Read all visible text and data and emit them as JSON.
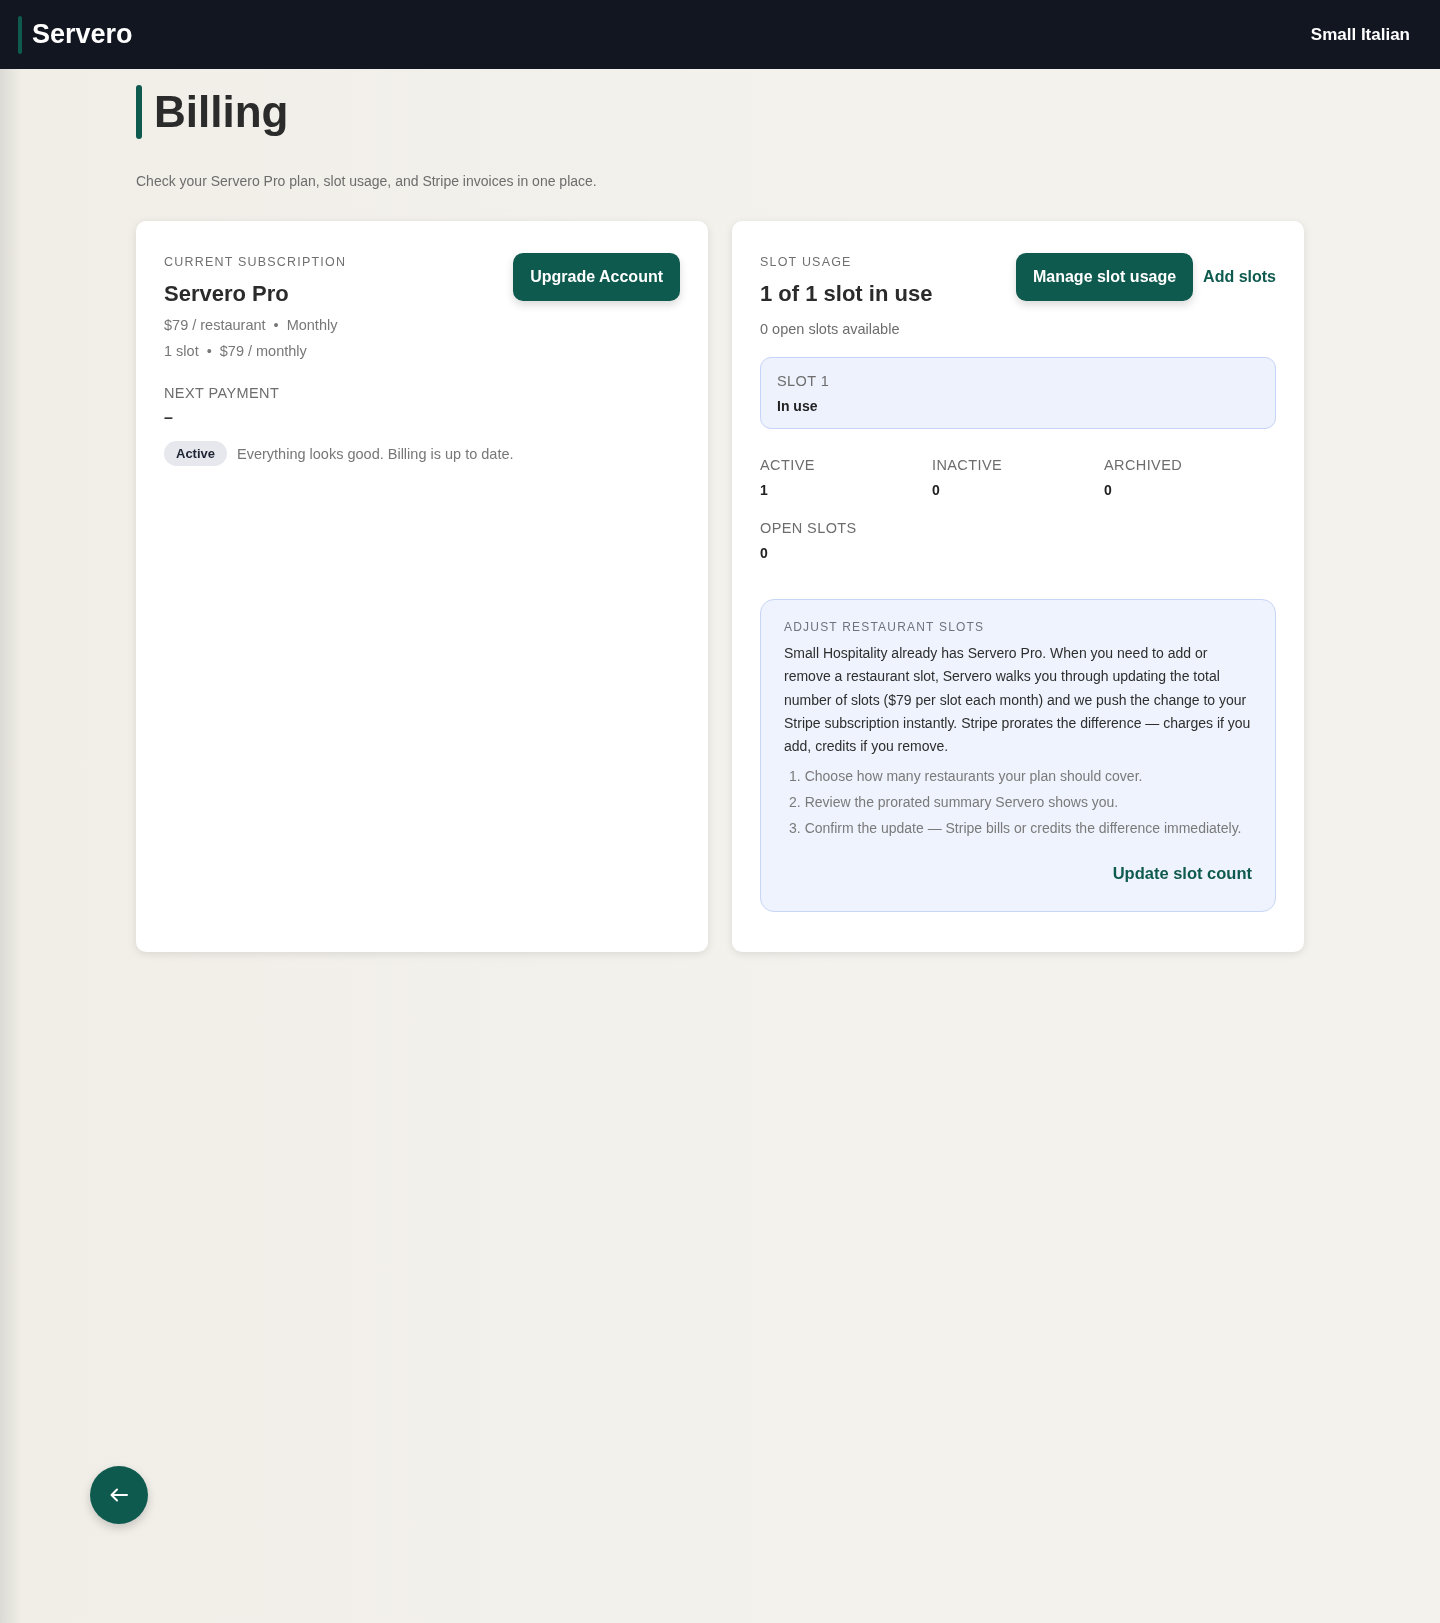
{
  "header": {
    "brand": "Servero",
    "account": "Small Italian"
  },
  "page": {
    "title": "Billing",
    "subtitle": "Check your Servero Pro plan, slot usage, and Stripe invoices in one place."
  },
  "subscription": {
    "eyebrow": "CURRENT SUBSCRIPTION",
    "plan": "Servero Pro",
    "price_line": [
      "$79 / restaurant",
      "•",
      "Monthly"
    ],
    "slot_line": [
      "1 slot",
      "•",
      "$79 / monthly"
    ],
    "next_payment_label": "NEXT PAYMENT",
    "next_payment_value": "–",
    "status": "Active",
    "status_message": "Everything looks good. Billing is up to date.",
    "upgrade_button": "Upgrade Account"
  },
  "slot_usage": {
    "eyebrow": "SLOT USAGE",
    "headline": "1 of 1 slot in use",
    "available": "0 open slots available",
    "manage_button": "Manage slot usage",
    "add_link": "Add slots",
    "slots": [
      {
        "label": "SLOT 1",
        "status": "In use"
      }
    ],
    "stats": [
      {
        "label": "ACTIVE",
        "value": "1"
      },
      {
        "label": "INACTIVE",
        "value": "0"
      },
      {
        "label": "ARCHIVED",
        "value": "0"
      },
      {
        "label": "OPEN SLOTS",
        "value": "0"
      }
    ],
    "adjust": {
      "eyebrow": "ADJUST RESTAURANT SLOTS",
      "body": "Small Hospitality already has Servero Pro. When you need to add or remove a restaurant slot, Servero walks you through updating the total number of slots ($79 per slot each month) and we push the change to your Stripe subscription instantly. Stripe prorates the difference — charges if you add, credits if you remove.",
      "steps": [
        {
          "number": "1.",
          "text": "Choose how many restaurants your plan should cover."
        },
        {
          "number": "2.",
          "text": "Review the prorated summary Servero shows you."
        },
        {
          "number": "3.",
          "text": "Confirm the update — Stripe bills or credits the difference immediately."
        }
      ],
      "action": "Update slot count"
    }
  }
}
